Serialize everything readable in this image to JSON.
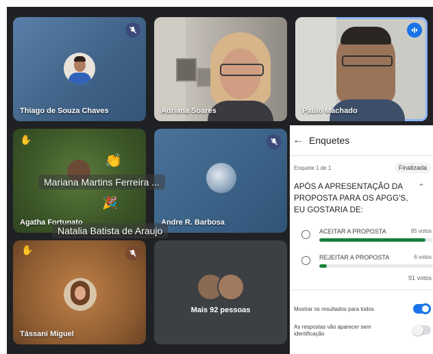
{
  "participants": [
    {
      "name": "Thiago de Souza Chaves",
      "status_icon": "mic-off-icon"
    },
    {
      "name": "Adriana Soares",
      "status_icon": ""
    },
    {
      "name": "Paulo Machado",
      "status_icon": "audio-level-icon"
    },
    {
      "name": "Agatha Fortunato",
      "status_icon": "hand-raised-icon"
    },
    {
      "name": "Andre R. Barbosa",
      "status_icon": "mic-off-icon"
    },
    {
      "name": "Tássani Miguel",
      "status_icon": "mic-off-icon"
    }
  ],
  "overlay_names": [
    "Mariana Martins Ferreira ...",
    "Natalia Batista de Araujo"
  ],
  "more_tile": {
    "label": "Mais 92 pessoas"
  },
  "polls": {
    "title": "Enquetes",
    "counter": "Enquete 1 de 1",
    "status": "Finalizada",
    "question": "APÓS A APRESENTAÇÃO DA PROPOSTA PARA OS APGG'S, EU GOSTARIA DE:",
    "options": [
      {
        "label": "ACEITAR A PROPOSTA",
        "votes": "85 votos",
        "fraction": 0.934
      },
      {
        "label": "REJEITAR A PROPOSTA",
        "votes": "6 votos",
        "fraction": 0.066
      }
    ],
    "total": "91 votos",
    "settings": [
      {
        "label": "Mostrar os resultados para todos",
        "enabled": true
      },
      {
        "label": "As respostas vão aparecer sem identificação",
        "enabled": false
      }
    ]
  },
  "colors": {
    "accent": "#1a73e8",
    "bar": "#188038",
    "mic_badge": "#3c4a7a",
    "background": "#202124"
  }
}
